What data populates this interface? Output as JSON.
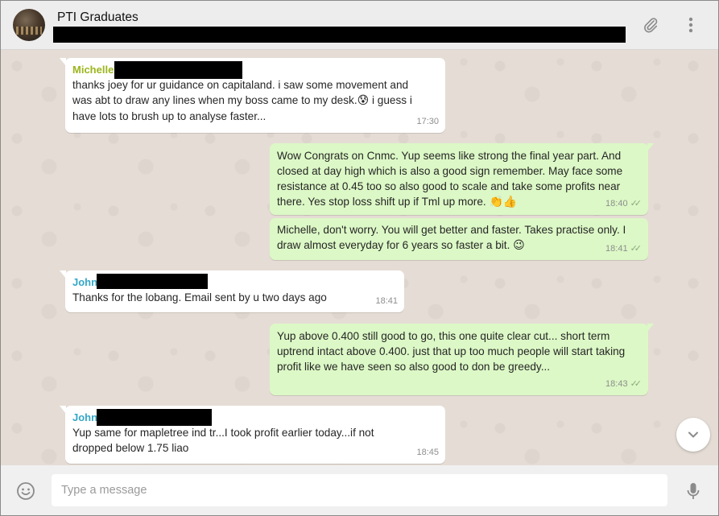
{
  "header": {
    "title": "PTI Graduates",
    "icons": [
      "paperclip-icon",
      "menu-icon"
    ]
  },
  "messages": [
    {
      "direction": "in",
      "sender": "Michelle",
      "sender_color": "#9db51c",
      "text": "thanks joey for ur guidance on capitaland. i saw some movement and was abt to draw any lines when my boss came to my desk.",
      "emoji": "😰",
      "text_after": " i guess i have lots to brush up to analyse faster...",
      "time": "17:30"
    },
    {
      "direction": "out",
      "text": "Wow Congrats on Cnmc. Yup seems like strong the final year part. And closed at day high which is also a good sign remember. May face some resistance at 0.45 too so also good to scale and take some profits near there. Yes stop loss shift up if Tml up more.",
      "emoji": "👏👍",
      "time": "18:40"
    },
    {
      "direction": "out",
      "text": "Michelle, don't worry. You will get better and faster. Takes practise only. I draw almost everyday for 6 years so faster a bit.",
      "emoji": "😉",
      "time": "18:41"
    },
    {
      "direction": "in",
      "sender": "John",
      "sender_color": "#35a7c7",
      "text": "Thanks for the lobang. Email sent by u two days ago",
      "time": "18:41"
    },
    {
      "direction": "out",
      "text": "Yup above 0.400 still good to go, this one quite clear cut... short term uptrend intact above 0.400. just that up too much people will start taking profit like we have seen so also good to don be greedy...",
      "time": "18:43"
    },
    {
      "direction": "in",
      "sender": "John",
      "sender_color": "#35a7c7",
      "text": "Yup same for mapletree ind tr...I took profit earlier today...if not dropped below 1.75 liao",
      "time": "18:45"
    }
  ],
  "composer": {
    "placeholder": "Type a message",
    "emoji_icon": "emoji-icon",
    "mic_icon": "microphone-icon"
  },
  "colors": {
    "incoming": "#ffffff",
    "outgoing": "#dcf8c6",
    "background": "#e5ddd5",
    "header": "#ededed"
  }
}
